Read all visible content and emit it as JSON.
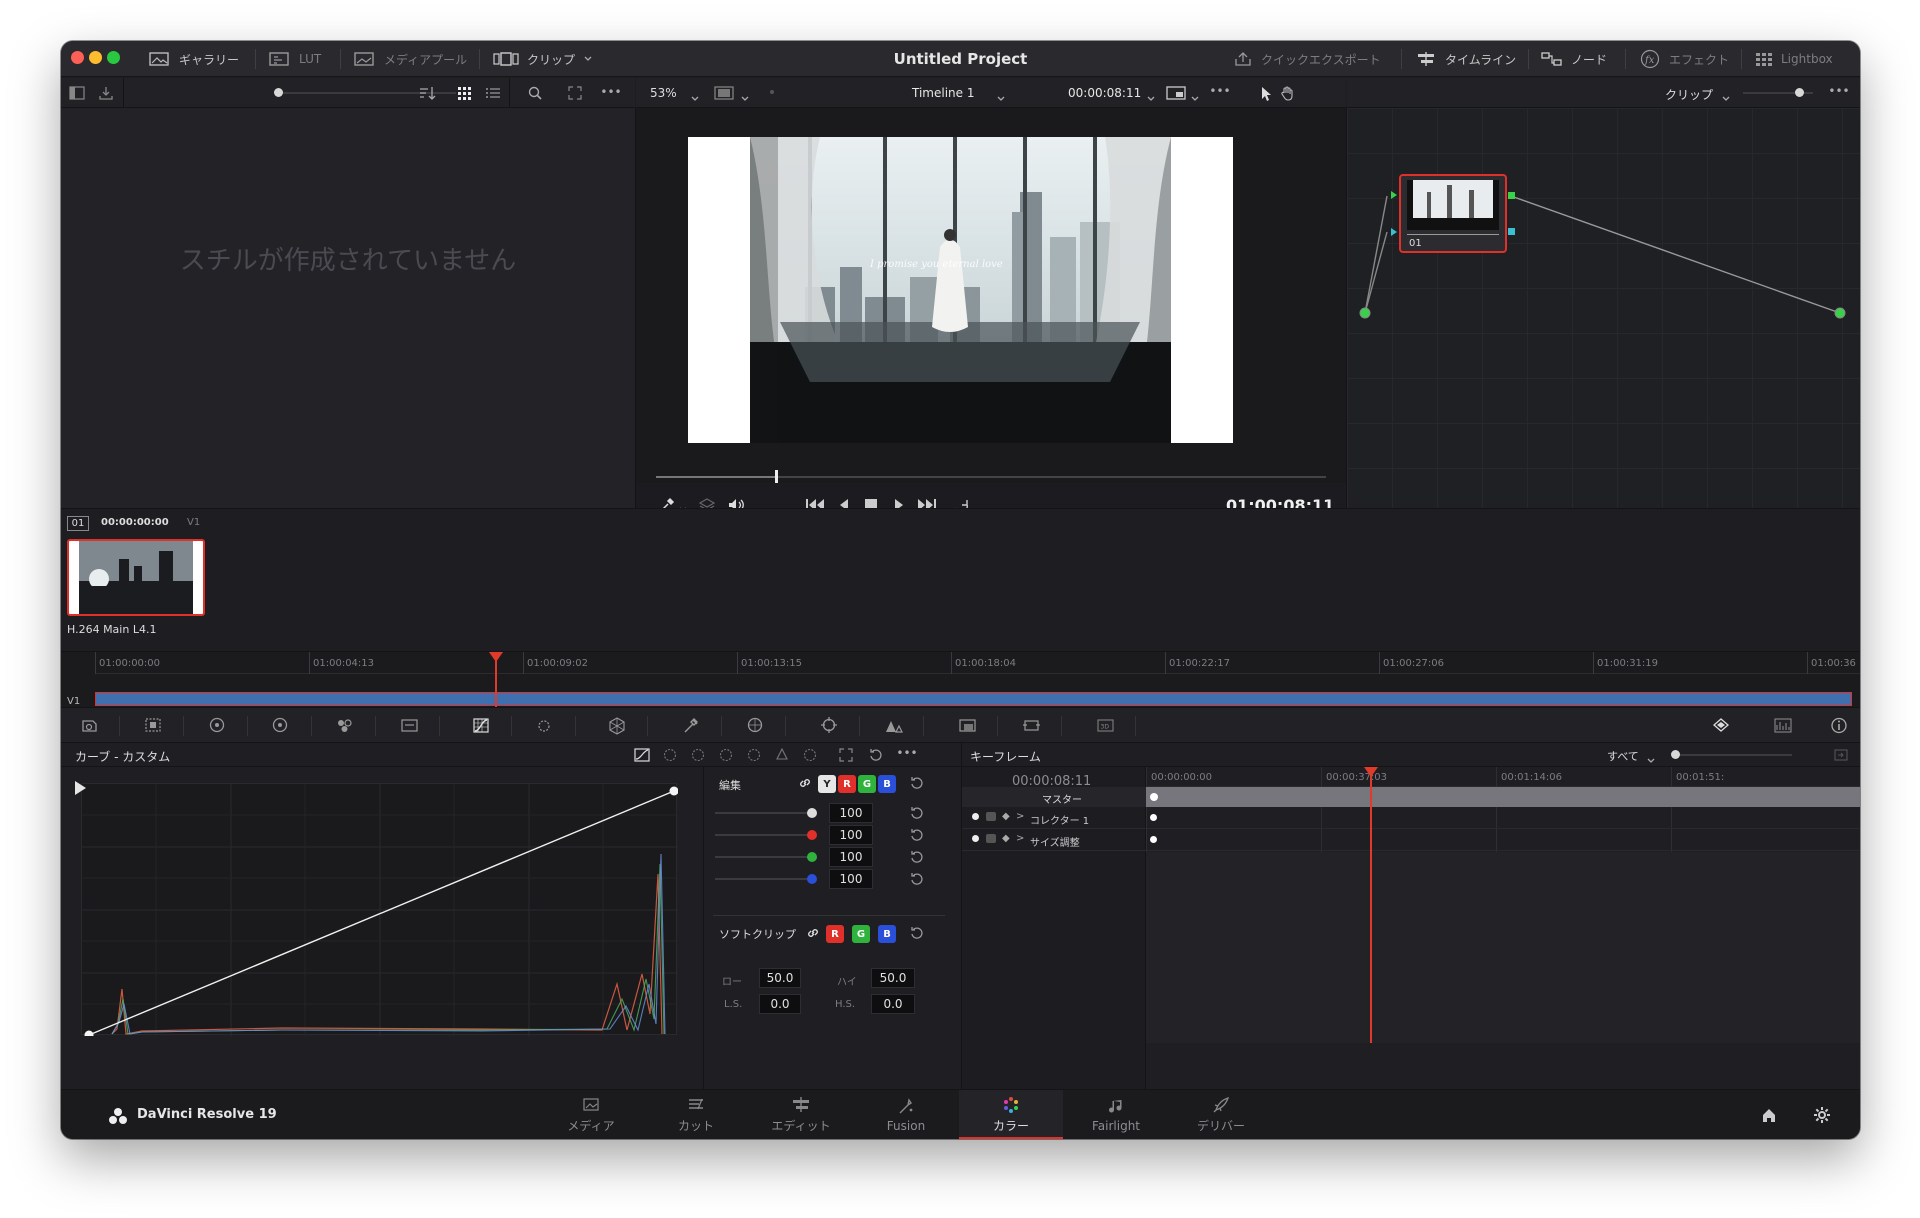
{
  "window": {
    "title": "Untitled Project"
  },
  "titlebar": {
    "gallery": "ギャラリー",
    "lut": "LUT",
    "media_pool": "メディアプール",
    "clip": "クリップ",
    "quick_export": "クイックエクスポート",
    "timeline": "タイムライン",
    "node": "ノード",
    "effects": "エフェクト",
    "lightbox": "Lightbox"
  },
  "viewer": {
    "zoom": "53%",
    "timeline_name": "Timeline 1",
    "timecode_top": "00:00:08:11",
    "timecode": "01:00:08:11",
    "overlay_text": "I promise you eternal love"
  },
  "node_panel": {
    "mode": "クリップ",
    "node_label": "01"
  },
  "gallery": {
    "empty_message": "スチルが作成されていません"
  },
  "clip_strip": {
    "clip_number": "01",
    "clip_timecode": "00:00:00:00",
    "track": "V1",
    "codec": "H.264 Main L4.1"
  },
  "timeline_ruler": {
    "track_label": "V1",
    "ticks": [
      "01:00:00:00",
      "01:00:04:13",
      "01:00:09:02",
      "01:00:13:15",
      "01:00:18:04",
      "01:00:22:17",
      "01:00:27:06",
      "01:00:31:19",
      "01:00:36"
    ]
  },
  "curves": {
    "title": "カーブ - カスタム",
    "edit_label": "編集",
    "channels": {
      "y": "Y",
      "r": "R",
      "g": "G",
      "b": "B"
    },
    "intensity_values": [
      "100",
      "100",
      "100",
      "100"
    ],
    "softclip_label": "ソフトクリップ",
    "low_label": "ロー",
    "low_value": "50.0",
    "high_label": "ハイ",
    "high_value": "50.0",
    "ls_label": "L.S.",
    "ls_value": "0.0",
    "hs_label": "H.S.",
    "hs_value": "0.0"
  },
  "keyframes": {
    "title": "キーフレーム",
    "filter": "すべて",
    "timecode": "00:00:08:11",
    "ticks": [
      "00:00:00:00",
      "00:00:37:03",
      "00:01:14:06",
      "00:01:51:"
    ],
    "rows": [
      "マスター",
      "コレクター 1",
      "サイズ調整"
    ]
  },
  "bottom_bar": {
    "app_name": "DaVinci Resolve 19",
    "pages": [
      "メディア",
      "カット",
      "エディット",
      "Fusion",
      "カラー",
      "Fairlight",
      "デリバー"
    ],
    "active_page": "カラー"
  },
  "colors": {
    "accent_red": "#e0302a",
    "playhead": "#e03a2a",
    "clip_blue": "#3f6fae"
  }
}
